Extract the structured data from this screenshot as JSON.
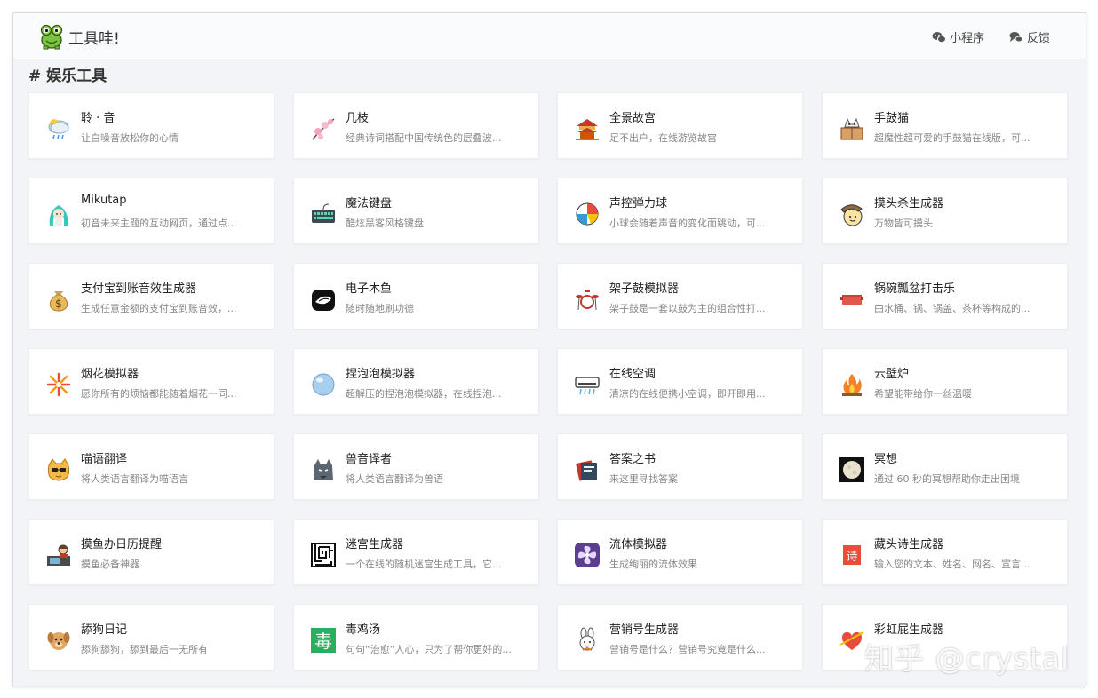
{
  "header": {
    "brand": "工具哇!",
    "links": [
      {
        "label": "小程序",
        "icon": "wechat-icon"
      },
      {
        "label": "反馈",
        "icon": "comments-icon"
      }
    ]
  },
  "section": {
    "title": "# 娱乐工具"
  },
  "cards": [
    {
      "title": "聆 · 音",
      "desc": "让白噪音放松你的心情",
      "icon": "rain-cloud-icon"
    },
    {
      "title": "几枝",
      "desc": "经典诗词搭配中国传统色的层叠波...",
      "icon": "plum-blossom-icon"
    },
    {
      "title": "全景故宫",
      "desc": "足不出户，在线游览故宫",
      "icon": "palace-icon"
    },
    {
      "title": "手鼓猫",
      "desc": "超魔性超可爱的手鼓猫在线版，可...",
      "icon": "drum-cat-icon"
    },
    {
      "title": "Mikutap",
      "desc": "初音未来主题的互动网页，通过点...",
      "icon": "miku-icon"
    },
    {
      "title": "魔法键盘",
      "desc": "酷炫黑客风格键盘",
      "icon": "keyboard-icon"
    },
    {
      "title": "声控弹力球",
      "desc": "小球会随着声音的变化而跳动，可...",
      "icon": "beach-ball-icon"
    },
    {
      "title": "摸头杀生成器",
      "desc": "万物皆可摸头",
      "icon": "pat-head-icon"
    },
    {
      "title": "支付宝到账音效生成器",
      "desc": "生成任意金额的支付宝到账音效，...",
      "icon": "money-bag-icon"
    },
    {
      "title": "电子木鱼",
      "desc": "随时随地刷功德",
      "icon": "wooden-fish-icon"
    },
    {
      "title": "架子鼓模拟器",
      "desc": "架子鼓是一套以鼓为主的组合性打...",
      "icon": "drum-kit-icon"
    },
    {
      "title": "锅碗瓢盆打击乐",
      "desc": "由水桶、锅、锅盖、茶杯等构成的...",
      "icon": "pot-icon"
    },
    {
      "title": "烟花模拟器",
      "desc": "愿你所有的烦恼都能随着烟花一同...",
      "icon": "firework-icon"
    },
    {
      "title": "捏泡泡模拟器",
      "desc": "超解压的捏泡泡模拟器，在线捏泡...",
      "icon": "bubble-icon"
    },
    {
      "title": "在线空调",
      "desc": "清凉的在线便携小空调，即开即用...",
      "icon": "air-conditioner-icon"
    },
    {
      "title": "云壁炉",
      "desc": "希望能带给你一丝温暖",
      "icon": "fire-icon"
    },
    {
      "title": "喵语翻译",
      "desc": "将人类语言翻译为喵语言",
      "icon": "cat-face-icon"
    },
    {
      "title": "兽音译者",
      "desc": "将人类语言翻译为兽语",
      "icon": "wolf-icon"
    },
    {
      "title": "答案之书",
      "desc": "来这里寻找答案",
      "icon": "book-icon"
    },
    {
      "title": "冥想",
      "desc": "通过 60 秒的冥想帮助你走出困境",
      "icon": "meditation-moon-icon"
    },
    {
      "title": "摸鱼办日历提醒",
      "desc": "摸鱼必备神器",
      "icon": "office-worker-icon"
    },
    {
      "title": "迷宫生成器",
      "desc": "一个在线的随机迷宫生成工具，它...",
      "icon": "maze-icon"
    },
    {
      "title": "流体模拟器",
      "desc": "生成绚丽的流体效果",
      "icon": "fluid-icon"
    },
    {
      "title": "藏头诗生成器",
      "desc": "输入您的文本、姓名、网名、宣言...",
      "icon": "poem-icon"
    },
    {
      "title": "舔狗日记",
      "desc": "舔狗舔狗，舔到最后一无所有",
      "icon": "dog-icon"
    },
    {
      "title": "毒鸡汤",
      "desc": "句句“治愈”人心，只为了帮你更好的...",
      "icon": "poison-icon"
    },
    {
      "title": "营销号生成器",
      "desc": "营销号是什么？营销号究竟是什么...",
      "icon": "rabbit-icon"
    },
    {
      "title": "彩虹屁生成器",
      "desc": "",
      "icon": "heart-arrow-icon"
    }
  ],
  "watermark": "知乎 @crystal",
  "colors": {
    "background": "#f2f4f7",
    "card": "#ffffff",
    "title": "#222222",
    "desc": "#888888"
  }
}
